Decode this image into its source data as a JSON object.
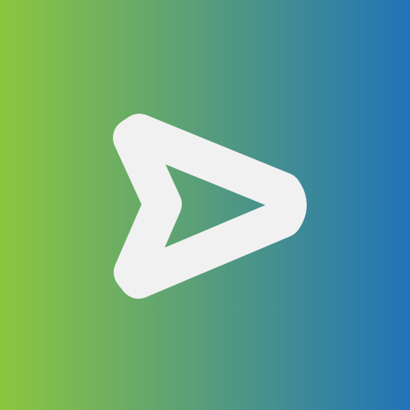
{
  "icon": {
    "name": "play-arrow-icon",
    "colors": {
      "gradient_start": "#8cc63f",
      "gradient_end": "#2174b8",
      "glyph": "#f1f1f1"
    }
  }
}
